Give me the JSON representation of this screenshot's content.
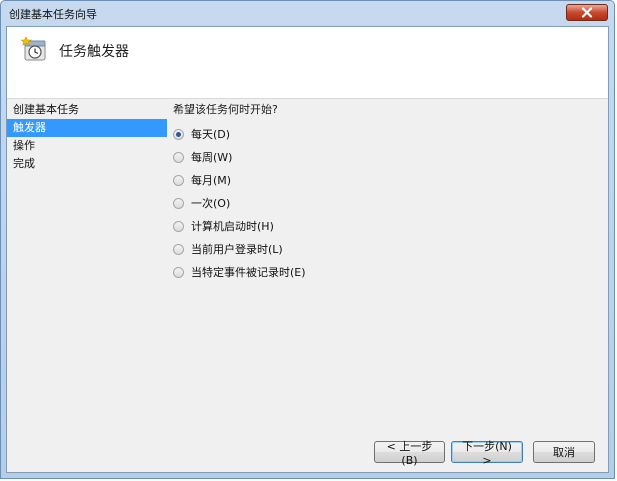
{
  "window": {
    "title": "创建基本任务向导"
  },
  "header": {
    "title": "任务触发器"
  },
  "nav": {
    "items": [
      {
        "label": "创建基本任务",
        "active": false
      },
      {
        "label": "触发器",
        "active": true
      },
      {
        "label": "操作",
        "active": false
      },
      {
        "label": "完成",
        "active": false
      }
    ]
  },
  "content": {
    "question": "希望该任务何时开始?",
    "options": [
      {
        "label": "每天(D)",
        "checked": true
      },
      {
        "label": "每周(W)",
        "checked": false
      },
      {
        "label": "每月(M)",
        "checked": false
      },
      {
        "label": "一次(O)",
        "checked": false
      },
      {
        "label": "计算机启动时(H)",
        "checked": false
      },
      {
        "label": "当前用户登录时(L)",
        "checked": false
      },
      {
        "label": "当特定事件被记录时(E)",
        "checked": false
      }
    ]
  },
  "buttons": {
    "back": "< 上一步(B)",
    "next": "下一步(N) >",
    "cancel": "取消"
  },
  "colors": {
    "selection": "#3399ff",
    "close_button": "#c84a2e",
    "title_bar": "#c6d9ee"
  }
}
